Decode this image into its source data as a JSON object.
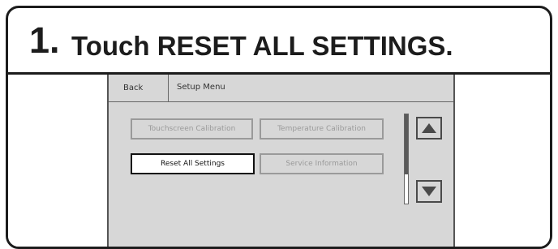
{
  "step": {
    "number": "1.",
    "instruction": "Touch RESET ALL SETTINGS."
  },
  "screen": {
    "back_label": "Back",
    "menu_title": "Setup Menu",
    "buttons": {
      "touchscreen_calibration": "Touchscreen Calibration",
      "temperature_calibration": "Temperature Calibration",
      "reset_all_settings": "Reset All Settings",
      "service_information": "Service Information"
    },
    "scroll": {
      "position_fraction": 0.0,
      "visible_fraction": 0.67
    },
    "icons": {
      "scroll_up": "up-arrow-icon",
      "scroll_down": "down-arrow-icon"
    }
  },
  "colors": {
    "screen_background": "#d7d7d7",
    "disabled_button": "#9a9a9a",
    "highlighted_button": "#111111"
  }
}
